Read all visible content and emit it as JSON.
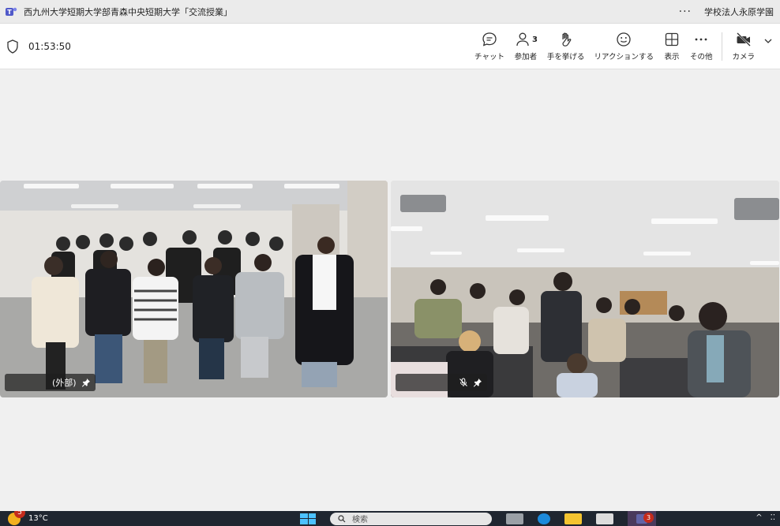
{
  "window": {
    "title": "西九州大学短期大学部青森中央短期大学「交流授業」",
    "org": "学校法人永原学園",
    "more_icon": "more-horizontal-icon"
  },
  "toolbar": {
    "timer": "01:53:50",
    "chat_label": "チャット",
    "participants_label": "参加者",
    "participants_count": "3",
    "raise_hand_label": "手を挙げる",
    "reactions_label": "リアクションする",
    "view_label": "表示",
    "more_label": "その他",
    "camera_label": "カメラ"
  },
  "tiles": [
    {
      "name_suffix": "(外部)",
      "pinned": true,
      "muted": false
    },
    {
      "name_suffix": "",
      "pinned": true,
      "muted": true
    }
  ],
  "taskbar": {
    "weather_badge": "5",
    "temperature": "13°C",
    "search_placeholder": "検索",
    "teams_badge": "3"
  },
  "colors": {
    "titlebar": "#ebebeb",
    "toolbar": "#ffffff",
    "stage": "#f0f0f0",
    "taskbar": "#1f2630",
    "badge_red": "#c42b1c"
  }
}
